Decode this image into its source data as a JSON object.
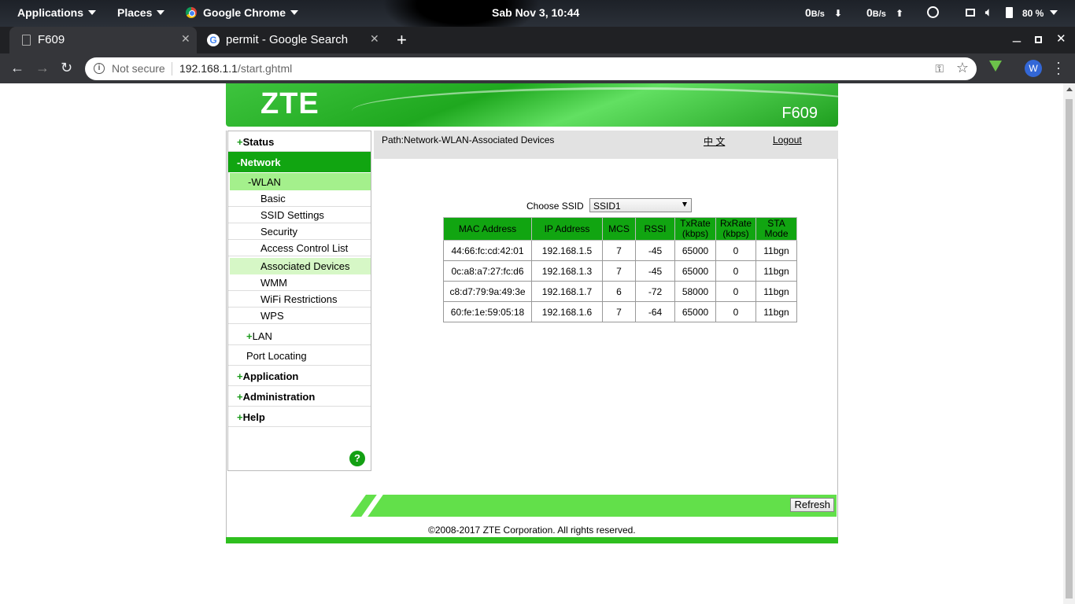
{
  "topbar": {
    "applications": "Applications",
    "places": "Places",
    "active_app": "Google Chrome",
    "clock": "Sab Nov  3, 10:44",
    "net_down": "0",
    "net_down_unit": "B/s",
    "net_up": "0",
    "net_up_unit": "B/s",
    "battery": "80 %"
  },
  "browser": {
    "tabs": [
      {
        "title": "F609"
      },
      {
        "title": "permit - Google Search"
      }
    ],
    "not_secure": "Not secure",
    "url_host": "192.168.1.1",
    "url_path": "/start.ghtml",
    "profile_initial": "W"
  },
  "router": {
    "logo": "ZTE",
    "model": "F609",
    "nav": {
      "status": "Status",
      "network": "Network",
      "wlan": "WLAN",
      "wlan_items": [
        "Basic",
        "SSID Settings",
        "Security",
        "Access Control List",
        "Associated Devices",
        "WMM",
        "WiFi Restrictions",
        "WPS"
      ],
      "lan": "LAN",
      "port_locating": "Port Locating",
      "application": "Application",
      "administration": "Administration",
      "help": "Help",
      "plus": "+",
      "minus": "-",
      "help_icon": "?"
    },
    "path": "Path:Network-WLAN-Associated Devices",
    "language": "中 文",
    "logout": "Logout",
    "ssid_label": "Choose SSID",
    "ssid_value": "SSID1",
    "table": {
      "headers": [
        "MAC Address",
        "IP Address",
        "MCS",
        "RSSI",
        "TxRate (kbps)",
        "RxRate (kbps)",
        "STA Mode"
      ],
      "rows": [
        [
          "44:66:fc:cd:42:01",
          "192.168.1.5",
          "7",
          "-45",
          "65000",
          "0",
          "11bgn"
        ],
        [
          "0c:a8:a7:27:fc:d6",
          "192.168.1.3",
          "7",
          "-45",
          "65000",
          "0",
          "11bgn"
        ],
        [
          "c8:d7:79:9a:49:3e",
          "192.168.1.7",
          "6",
          "-72",
          "58000",
          "0",
          "11bgn"
        ],
        [
          "60:fe:1e:59:05:18",
          "192.168.1.6",
          "7",
          "-64",
          "65000",
          "0",
          "11bgn"
        ]
      ]
    },
    "refresh": "Refresh",
    "copyright": "©2008-2017 ZTE Corporation. All rights reserved."
  },
  "colors": {
    "zte_green": "#11a511",
    "wlan_highlight": "#a4f08c",
    "selected_item": "#d6f7c6",
    "footer_green": "#62e04a"
  }
}
